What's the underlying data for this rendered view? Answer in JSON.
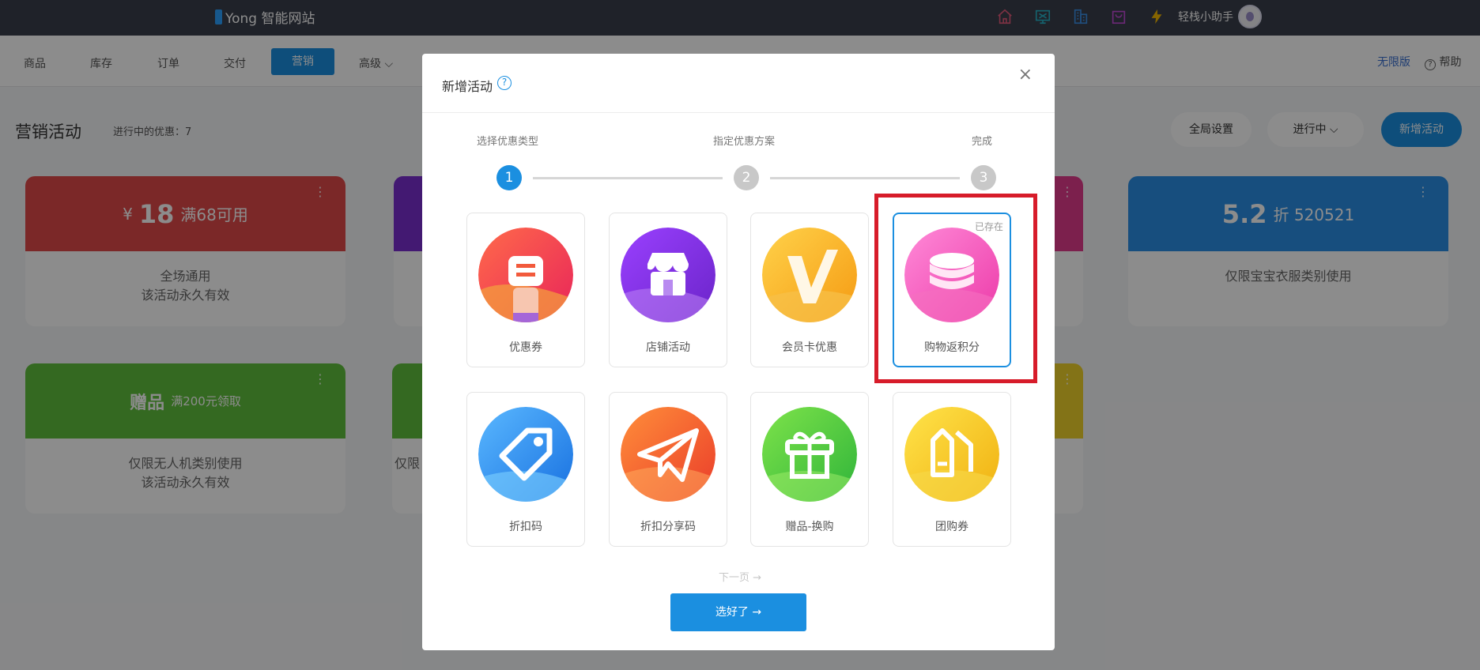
{
  "topbar": {
    "logo_prefix": "i",
    "logo_text": "Yong 智能网站",
    "icons": [
      "home-icon",
      "monitor-icon",
      "building-icon",
      "bag-icon",
      "lightning-icon"
    ],
    "assistant_label": "轻栈小助手"
  },
  "nav": {
    "items": [
      "商品",
      "库存",
      "订单",
      "交付",
      "营销",
      "高级 ⌵"
    ],
    "active": "营销",
    "unlimited": "无限版",
    "help": "帮助"
  },
  "page": {
    "title": "营销活动",
    "running_label": "进行中的优惠：7",
    "global_settings": "全局设置",
    "status_filter": "进行中 ⌵",
    "add_activity": "新增活动"
  },
  "background_cards": [
    {
      "head_prefix": "¥",
      "head_big": "18",
      "head_small": "满68可用",
      "line1": "全场通用",
      "line2": "该活动永久有效",
      "color": "#e04a4a"
    },
    {
      "head_prefix": "",
      "head_big": "5.2",
      "head_small": "折 520521",
      "line1": "仅限宝宝衣服类别使用",
      "line2": "",
      "color": "#2b8fe6"
    },
    {
      "head_prefix": "",
      "head_big": "赠品",
      "head_small": "满200元领取",
      "line1": "仅限无人机类别使用",
      "line2": "该活动永久有效",
      "color": "#5fbf3c"
    },
    {
      "head_prefix": "",
      "head_big": "",
      "head_small": "",
      "line1": "仅限",
      "line2": "",
      "color": "#5fbf3c"
    }
  ],
  "modal": {
    "title": "新增活动",
    "help_symbol": "?",
    "close_symbol": "×",
    "steps": [
      {
        "label": "选择优惠类型",
        "number": "1"
      },
      {
        "label": "指定优惠方案",
        "number": "2"
      },
      {
        "label": "完成",
        "number": "3"
      }
    ],
    "options": [
      {
        "label": "优惠券",
        "icon": "coupon-icon",
        "color": "#f25a3c"
      },
      {
        "label": "店铺活动",
        "icon": "store-icon",
        "color": "#8a3ae0"
      },
      {
        "label": "会员卡优惠",
        "icon": "member-card-icon",
        "color": "#f5b21e"
      },
      {
        "label": "购物返积分",
        "icon": "coins-icon",
        "color": "#f25fc2",
        "tag": "已存在"
      },
      {
        "label": "折扣码",
        "icon": "tag-icon",
        "color": "#2c8ff0"
      },
      {
        "label": "折扣分享码",
        "icon": "paper-plane-icon",
        "color": "#f0652a"
      },
      {
        "label": "赠品-换购",
        "icon": "gift-icon",
        "color": "#4fc93c"
      },
      {
        "label": "团购券",
        "icon": "group-tag-icon",
        "color": "#ecc81a"
      }
    ],
    "next_page": "下一页 →",
    "confirm_button": "选好了 →"
  }
}
